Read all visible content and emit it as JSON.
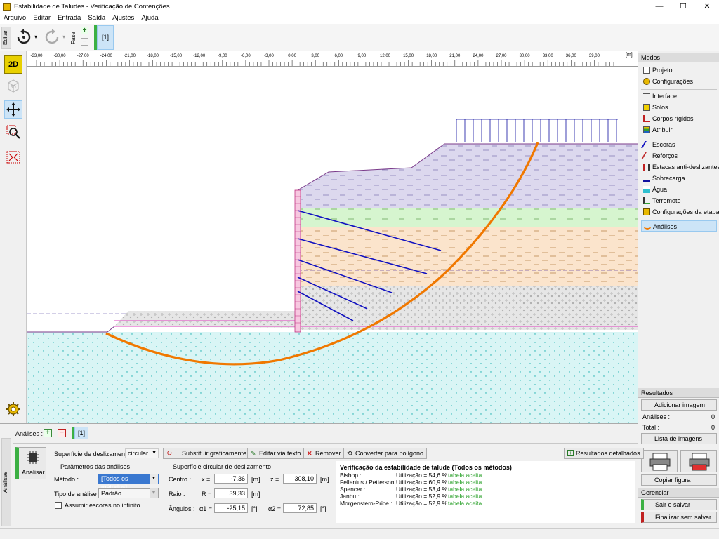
{
  "window": {
    "title": "Estabilidade de Taludes - Verificação de Contenções",
    "minimize": "—",
    "maximize": "☐",
    "close": "✕"
  },
  "menu": [
    "Arquivo",
    "Editar",
    "Entrada",
    "Saída",
    "Ajustes",
    "Ajuda"
  ],
  "toolbar": {
    "editar_label": "Editar",
    "fase_label": "Fase",
    "stage_label": "[1]"
  },
  "view": {
    "mode_2d": "2D",
    "mode_3d": "3D"
  },
  "ruler": {
    "unit": "[m]",
    "ticks": [
      "-33,00",
      "-30,00",
      "-27,00",
      "-24,00",
      "-21,00",
      "-18,00",
      "-15,00",
      "-12,00",
      "-9,00",
      "-6,00",
      "-3,00",
      "0,00",
      "3,00",
      "6,00",
      "9,00",
      "12,00",
      "15,00",
      "18,00",
      "21,00",
      "24,00",
      "27,00",
      "30,00",
      "33,00",
      "36,00",
      "39,00"
    ]
  },
  "colors": {
    "water": "#d9f5f5",
    "layer_purple": "#dcd8ee",
    "layer_green": "#d6f5cf",
    "layer_orange": "#fbe4cc",
    "layer_gray": "#e6e6e6",
    "slip": "#f07800",
    "anchor": "#1010c0",
    "wall": "#e070a0",
    "accent_green": "#3cb043"
  },
  "right_panel": {
    "modes_title": "Modos",
    "modes": [
      {
        "label": "Projeto",
        "icon": "document-icon"
      },
      {
        "label": "Configurações",
        "icon": "gear-icon"
      }
    ],
    "inputs": [
      {
        "label": "Interface",
        "icon": "interface-icon"
      },
      {
        "label": "Solos",
        "icon": "soil-icon"
      },
      {
        "label": "Corpos rígidos",
        "icon": "rigid-body-icon"
      },
      {
        "label": "Atribuir",
        "icon": "assign-icon"
      }
    ],
    "stage_items": [
      {
        "label": "Escoras",
        "icon": "anchor-icon"
      },
      {
        "label": "Reforços",
        "icon": "reinforcement-icon"
      },
      {
        "label": "Estacas anti-deslizantes",
        "icon": "pile-icon"
      },
      {
        "label": "Sobrecarga",
        "icon": "surcharge-icon"
      },
      {
        "label": "Água",
        "icon": "water-icon"
      },
      {
        "label": "Terremoto",
        "icon": "earthquake-icon"
      },
      {
        "label": "Configurações da etapa",
        "icon": "stage-settings-icon"
      },
      {
        "label": "Análises",
        "icon": "analysis-icon"
      }
    ],
    "results_title": "Resultados",
    "add_image": "Adicionar imagem",
    "analyses_label": "Análises :",
    "analyses_count": "0",
    "total_label": "Total :",
    "total_count": "0",
    "image_list": "Lista de imagens",
    "copy_figure": "Copiar figura",
    "manage_title": "Gerenciar",
    "exit_save": "Sair e salvar",
    "exit_nosave": "Finalizar sem salvar"
  },
  "bottom": {
    "side_label": "Análises",
    "analyses_label": "Análises :",
    "tab": "[1]",
    "analyze": "Analisar",
    "surface_label": "Superfície de deslizamento :",
    "surface_value": "circular",
    "btn_replace": "Substituir graficamente",
    "btn_edit_text": "Editar via texto",
    "btn_remove": "Remover",
    "btn_convert": "Converter para polígono",
    "btn_details": "Resultados detalhados",
    "params_title": "Parâmetros das análises",
    "method_label": "Método :",
    "method_value": "[Todos os métodos]",
    "type_label": "Tipo de análise :",
    "type_value": "Padrão",
    "infinite_label": "Assumir escoras no infinito",
    "circ_title": "Superfície circular de deslizamento",
    "center_label": "Centro :",
    "x_label": "x =",
    "x_value": "-7,36",
    "x_unit": "[m]",
    "z_label": "z =",
    "z_value": "308,10",
    "z_unit": "[m]",
    "radius_label": "Raio :",
    "r_label": "R =",
    "r_value": "39,33",
    "r_unit": "[m]",
    "angles_label": "Ângulos :",
    "a1_label": "α1 =",
    "a1_value": "-25,15",
    "a1_unit": "[°]",
    "a2_label": "α2 =",
    "a2_value": "72,85",
    "a2_unit": "[°]"
  },
  "results": {
    "title": "Verificação da estabilidade de talude (Todos os métodos)",
    "rows": [
      {
        "method": "Bishop :",
        "util": "Utilização = 54,6 %",
        "status": "tabela aceita"
      },
      {
        "method": "Fellenius / Petterson :",
        "util": "Utilização = 60,9 %",
        "status": "tabela aceita"
      },
      {
        "method": "Spencer :",
        "util": "Utilização = 53,4 %",
        "status": "tabela aceita"
      },
      {
        "method": "Janbu :",
        "util": "Utilização = 52,9 %",
        "status": "tabela aceita"
      },
      {
        "method": "Morgenstern-Price :",
        "util": "Utilização = 52,9 %",
        "status": "tabela aceita"
      }
    ]
  }
}
